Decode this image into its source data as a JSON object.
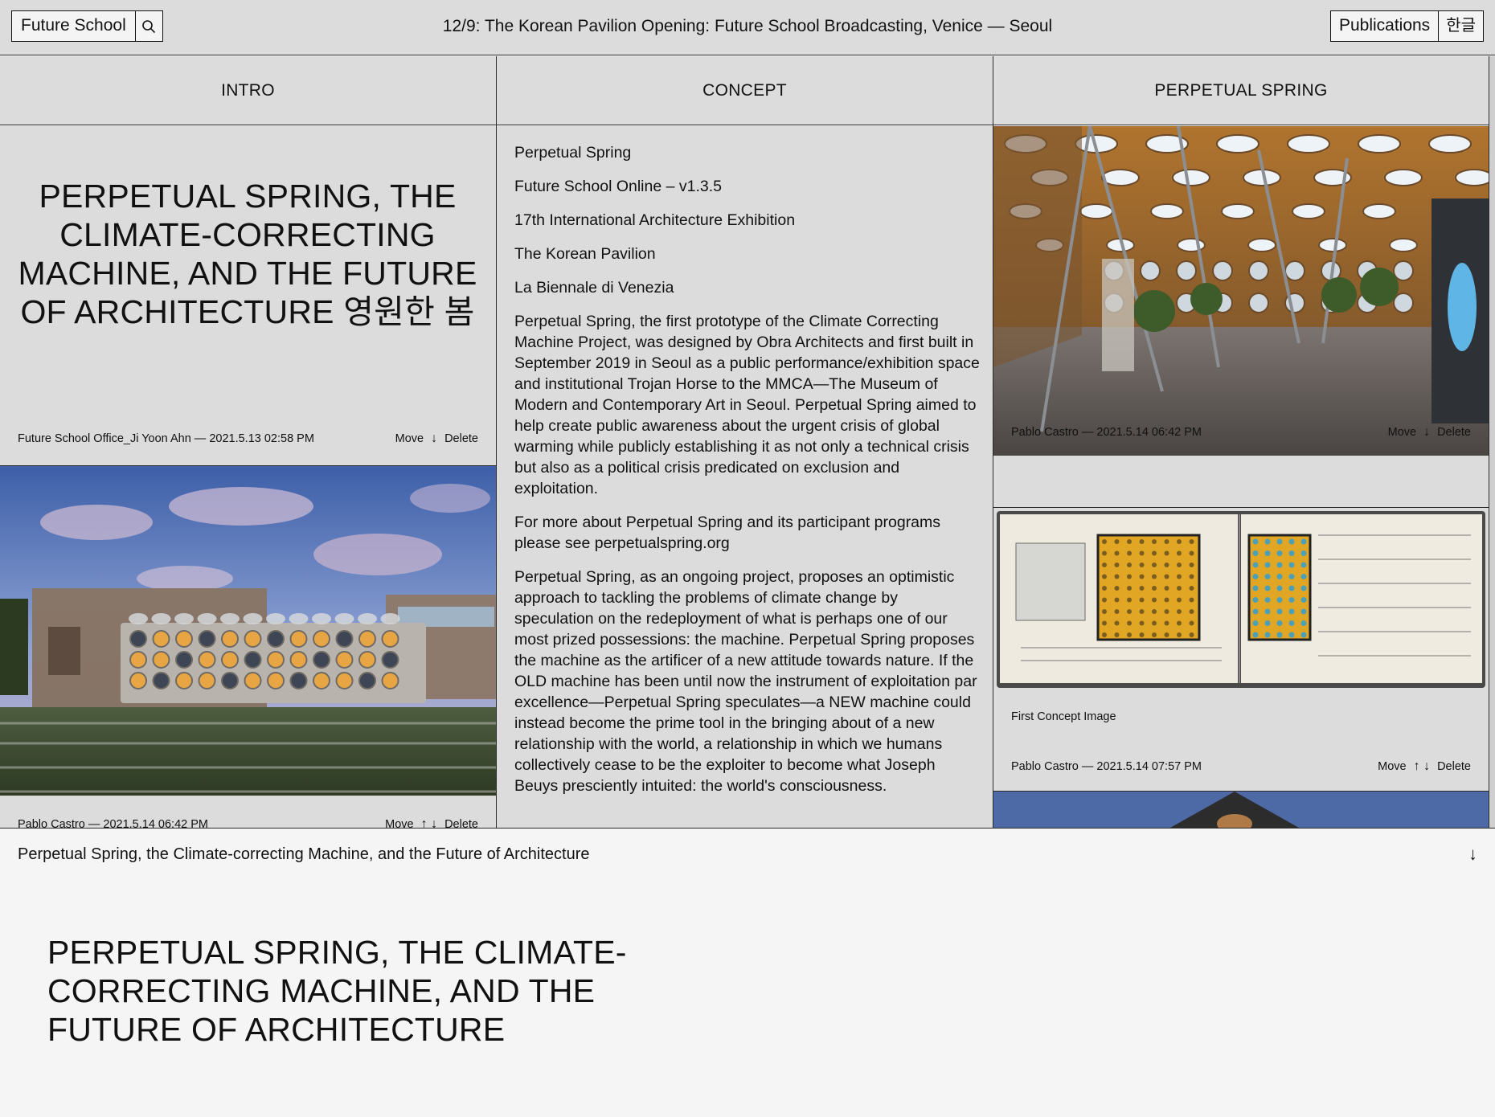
{
  "topbar": {
    "brand": "Future School",
    "search_icon": "search-icon",
    "announcement": "12/9: The Korean Pavilion Opening: Future School Broadcasting, Venice — Seoul",
    "publications_label": "Publications",
    "language_label": "한글"
  },
  "columns": {
    "intro": {
      "header": "INTRO",
      "title": "PERPETUAL SPRING, THE CLIMATE-CORRECTING MACHINE, AND THE FUTURE OF ARCHITECTURE 영원한 봄",
      "meta1": {
        "author_date": "Future School Office_Ji Yoon Ahn — 2021.5.13 02:58 PM",
        "move": "Move",
        "arrows": "↓",
        "delete": "Delete"
      },
      "image1_alt": "pavilion-exterior-photo",
      "meta2": {
        "author_date": "Pablo Castro — 2021.5.14 06:42 PM",
        "move": "Move",
        "arrows": "↑ ↓",
        "delete": "Delete"
      }
    },
    "concept": {
      "header": "CONCEPT",
      "lines": [
        "Perpetual Spring",
        "Future School Online – v1.3.5",
        "17th International Architecture Exhibition",
        "The Korean Pavilion",
        "La Biennale di Venezia"
      ],
      "paragraphs": [
        "Perpetual Spring, the first prototype of the Climate Correcting Machine Project, was designed by Obra Architects and first built in September 2019 in Seoul as a public performance/exhibition space and institutional Trojan Horse to the MMCA—The Museum of Modern and Contemporary Art in Seoul. Perpetual Spring aimed to help create public awareness about the urgent crisis of global warming while publicly establishing it as not only a technical crisis but also as a political crisis predicated on exclusion and exploitation.",
        "For more about Perpetual Spring and its participant programs please see perpetualspring.org",
        "Perpetual Spring, as an ongoing project, proposes an optimistic approach to tackling the problems of climate change by speculation on the redeployment of what is perhaps one of our most prized possessions: the machine. Perpetual Spring proposes the machine as the artificer of a new attitude towards nature. If the OLD machine has been until now the instrument of exploitation par excellence—Perpetual Spring speculates—a NEW machine could instead become the prime tool in the bringing about of a new relationship with the world, a relationship in which we humans collectively cease to be the exploiter to become what Joseph Beuys presciently intuited: the world's consciousness."
      ]
    },
    "perpetual": {
      "header": "PERPETUAL SPRING",
      "image1_alt": "pavilion-interior-photo",
      "meta1": {
        "author_date": "Pablo Castro — 2021.5.14 06:42 PM",
        "move": "Move",
        "arrows": "↓",
        "delete": "Delete"
      },
      "image2_alt": "concept-sketchbook-image",
      "caption2": "First Concept Image",
      "meta2": {
        "author_date": "Pablo Castro — 2021.5.14 07:57 PM",
        "move": "Move",
        "arrows": "↑ ↓",
        "delete": "Delete"
      }
    }
  },
  "bottom": {
    "bar_title": "Perpetual Spring, the Climate-correcting Machine, and the Future of Architecture",
    "toggle_arrow": "↓",
    "big_title": "PERPETUAL SPRING, THE CLIMATE-CORRECTING MACHINE, AND THE FUTURE OF ARCHITECTURE"
  }
}
